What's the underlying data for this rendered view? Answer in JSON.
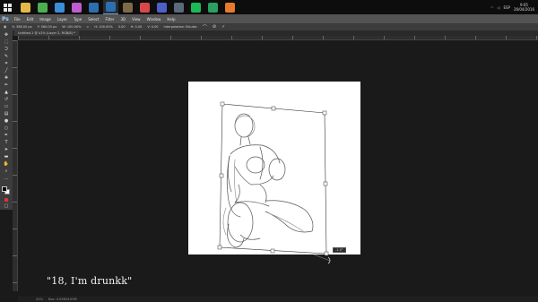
{
  "taskbar": {
    "apps": [
      {
        "icon": "folder-icon",
        "color": "#e6b84a"
      },
      {
        "icon": "chrome-icon",
        "color": "#4caf50"
      },
      {
        "icon": "image-viewer-icon",
        "color": "#3a8fd8"
      },
      {
        "icon": "video-icon",
        "color": "#c05cd0"
      },
      {
        "icon": "photoshop-icon",
        "color": "#2c6fb0"
      },
      {
        "icon": "photoshop-icon-2",
        "color": "#2c6fb0"
      },
      {
        "icon": "gimp-icon",
        "color": "#7f6a48"
      },
      {
        "icon": "pin-icon",
        "color": "#d94848"
      },
      {
        "icon": "calendar-icon",
        "color": "#4f5fc8"
      },
      {
        "icon": "steam-icon",
        "color": "#5a6a7a"
      },
      {
        "icon": "spotify-icon",
        "color": "#1db954"
      },
      {
        "icon": "media-icon",
        "color": "#2aa060"
      },
      {
        "icon": "firefox-icon",
        "color": "#e87a2a"
      }
    ],
    "tray_lang": "ESP",
    "time": "9:05",
    "date": "26/04/2016"
  },
  "app": {
    "logo": "Ps",
    "menu": [
      "File",
      "Edit",
      "Image",
      "Layer",
      "Type",
      "Select",
      "Filter",
      "3D",
      "View",
      "Window",
      "Help"
    ]
  },
  "options": {
    "fields": [
      "X: 388.00 px",
      "Y: 560.00 px",
      "W: 100.00%",
      "H: 100.00%",
      "0.00",
      "H: 0.00",
      "V: 0.00",
      "Interpolation: Bicubic"
    ]
  },
  "document": {
    "tab_title": "Untitled-1 @ 41% (Layer 2, RGB/8) *"
  },
  "status": {
    "zoom": "41%",
    "doc_info": "Doc: 4.05M/4.05M"
  },
  "transform_readout": "-1.0°",
  "caption": "\"18, I'm drunkk\""
}
